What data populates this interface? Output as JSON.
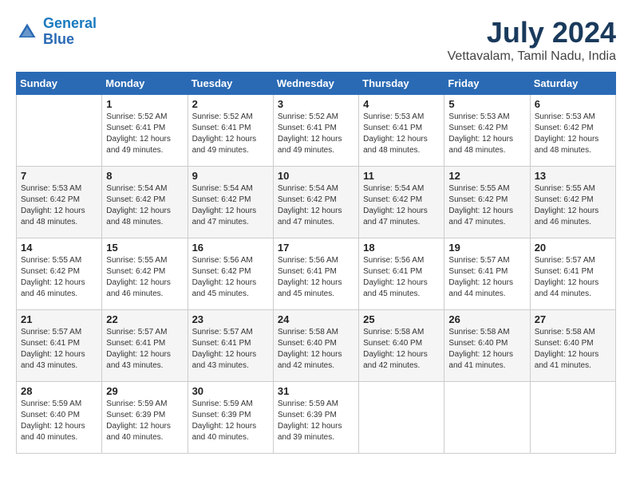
{
  "logo": {
    "line1": "General",
    "line2": "Blue"
  },
  "title": "July 2024",
  "location": "Vettavalam, Tamil Nadu, India",
  "days_of_week": [
    "Sunday",
    "Monday",
    "Tuesday",
    "Wednesday",
    "Thursday",
    "Friday",
    "Saturday"
  ],
  "weeks": [
    [
      {
        "day": "",
        "info": ""
      },
      {
        "day": "1",
        "info": "Sunrise: 5:52 AM\nSunset: 6:41 PM\nDaylight: 12 hours\nand 49 minutes."
      },
      {
        "day": "2",
        "info": "Sunrise: 5:52 AM\nSunset: 6:41 PM\nDaylight: 12 hours\nand 49 minutes."
      },
      {
        "day": "3",
        "info": "Sunrise: 5:52 AM\nSunset: 6:41 PM\nDaylight: 12 hours\nand 49 minutes."
      },
      {
        "day": "4",
        "info": "Sunrise: 5:53 AM\nSunset: 6:41 PM\nDaylight: 12 hours\nand 48 minutes."
      },
      {
        "day": "5",
        "info": "Sunrise: 5:53 AM\nSunset: 6:42 PM\nDaylight: 12 hours\nand 48 minutes."
      },
      {
        "day": "6",
        "info": "Sunrise: 5:53 AM\nSunset: 6:42 PM\nDaylight: 12 hours\nand 48 minutes."
      }
    ],
    [
      {
        "day": "7",
        "info": "Sunrise: 5:53 AM\nSunset: 6:42 PM\nDaylight: 12 hours\nand 48 minutes."
      },
      {
        "day": "8",
        "info": "Sunrise: 5:54 AM\nSunset: 6:42 PM\nDaylight: 12 hours\nand 48 minutes."
      },
      {
        "day": "9",
        "info": "Sunrise: 5:54 AM\nSunset: 6:42 PM\nDaylight: 12 hours\nand 47 minutes."
      },
      {
        "day": "10",
        "info": "Sunrise: 5:54 AM\nSunset: 6:42 PM\nDaylight: 12 hours\nand 47 minutes."
      },
      {
        "day": "11",
        "info": "Sunrise: 5:54 AM\nSunset: 6:42 PM\nDaylight: 12 hours\nand 47 minutes."
      },
      {
        "day": "12",
        "info": "Sunrise: 5:55 AM\nSunset: 6:42 PM\nDaylight: 12 hours\nand 47 minutes."
      },
      {
        "day": "13",
        "info": "Sunrise: 5:55 AM\nSunset: 6:42 PM\nDaylight: 12 hours\nand 46 minutes."
      }
    ],
    [
      {
        "day": "14",
        "info": "Sunrise: 5:55 AM\nSunset: 6:42 PM\nDaylight: 12 hours\nand 46 minutes."
      },
      {
        "day": "15",
        "info": "Sunrise: 5:55 AM\nSunset: 6:42 PM\nDaylight: 12 hours\nand 46 minutes."
      },
      {
        "day": "16",
        "info": "Sunrise: 5:56 AM\nSunset: 6:42 PM\nDaylight: 12 hours\nand 45 minutes."
      },
      {
        "day": "17",
        "info": "Sunrise: 5:56 AM\nSunset: 6:41 PM\nDaylight: 12 hours\nand 45 minutes."
      },
      {
        "day": "18",
        "info": "Sunrise: 5:56 AM\nSunset: 6:41 PM\nDaylight: 12 hours\nand 45 minutes."
      },
      {
        "day": "19",
        "info": "Sunrise: 5:57 AM\nSunset: 6:41 PM\nDaylight: 12 hours\nand 44 minutes."
      },
      {
        "day": "20",
        "info": "Sunrise: 5:57 AM\nSunset: 6:41 PM\nDaylight: 12 hours\nand 44 minutes."
      }
    ],
    [
      {
        "day": "21",
        "info": "Sunrise: 5:57 AM\nSunset: 6:41 PM\nDaylight: 12 hours\nand 43 minutes."
      },
      {
        "day": "22",
        "info": "Sunrise: 5:57 AM\nSunset: 6:41 PM\nDaylight: 12 hours\nand 43 minutes."
      },
      {
        "day": "23",
        "info": "Sunrise: 5:57 AM\nSunset: 6:41 PM\nDaylight: 12 hours\nand 43 minutes."
      },
      {
        "day": "24",
        "info": "Sunrise: 5:58 AM\nSunset: 6:40 PM\nDaylight: 12 hours\nand 42 minutes."
      },
      {
        "day": "25",
        "info": "Sunrise: 5:58 AM\nSunset: 6:40 PM\nDaylight: 12 hours\nand 42 minutes."
      },
      {
        "day": "26",
        "info": "Sunrise: 5:58 AM\nSunset: 6:40 PM\nDaylight: 12 hours\nand 41 minutes."
      },
      {
        "day": "27",
        "info": "Sunrise: 5:58 AM\nSunset: 6:40 PM\nDaylight: 12 hours\nand 41 minutes."
      }
    ],
    [
      {
        "day": "28",
        "info": "Sunrise: 5:59 AM\nSunset: 6:40 PM\nDaylight: 12 hours\nand 40 minutes."
      },
      {
        "day": "29",
        "info": "Sunrise: 5:59 AM\nSunset: 6:39 PM\nDaylight: 12 hours\nand 40 minutes."
      },
      {
        "day": "30",
        "info": "Sunrise: 5:59 AM\nSunset: 6:39 PM\nDaylight: 12 hours\nand 40 minutes."
      },
      {
        "day": "31",
        "info": "Sunrise: 5:59 AM\nSunset: 6:39 PM\nDaylight: 12 hours\nand 39 minutes."
      },
      {
        "day": "",
        "info": ""
      },
      {
        "day": "",
        "info": ""
      },
      {
        "day": "",
        "info": ""
      }
    ]
  ]
}
